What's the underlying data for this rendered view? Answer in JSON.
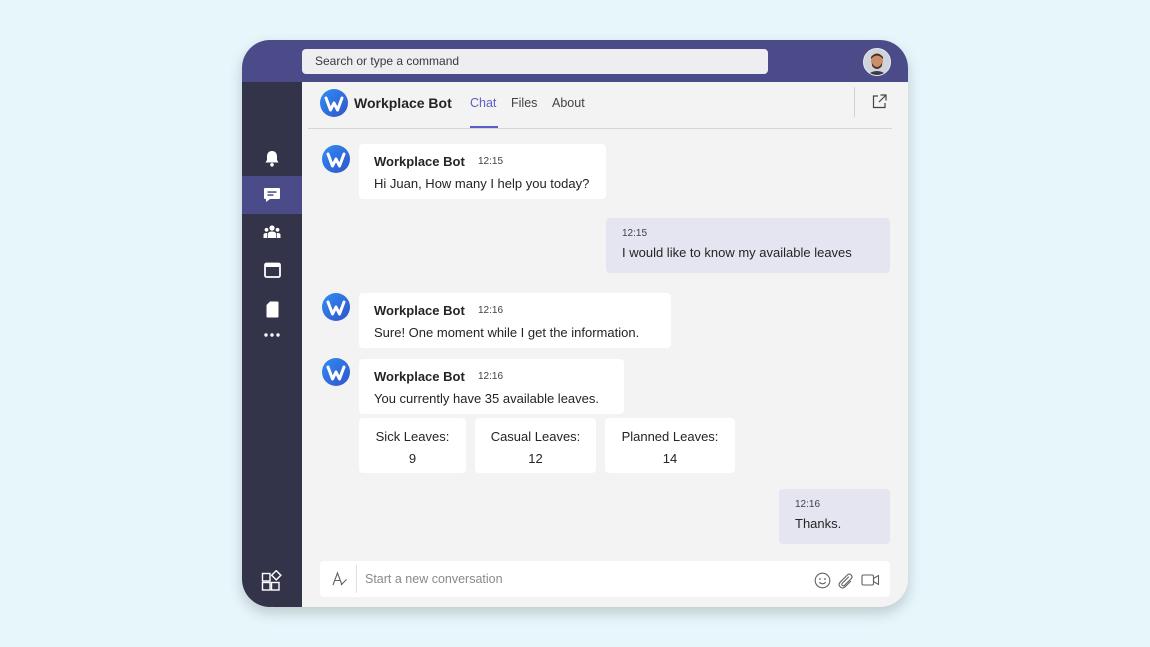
{
  "search": {
    "placeholder": "Search or type a command"
  },
  "header": {
    "bot_name": "Workplace Bot",
    "tabs": [
      {
        "label": "Chat",
        "active": true
      },
      {
        "label": "Files",
        "active": false
      },
      {
        "label": "About",
        "active": false
      }
    ]
  },
  "rail": {
    "items": [
      "bell-icon",
      "chat-icon",
      "teams-icon",
      "calendar-icon",
      "files-icon",
      "more-icon",
      "apps-icon",
      "help-icon"
    ],
    "active": "chat-icon"
  },
  "messages": [
    {
      "from": "bot",
      "name": "Workplace Bot",
      "time": "12:15",
      "text": "Hi Juan, How many I help you today?"
    },
    {
      "from": "me",
      "time": "12:15",
      "text": "I would like to know my available leaves"
    },
    {
      "from": "bot",
      "name": "Workplace Bot",
      "time": "12:16",
      "text": "Sure! One moment while I get the information."
    },
    {
      "from": "bot",
      "name": "Workplace Bot",
      "time": "12:16",
      "text": "You currently have 35 available leaves."
    },
    {
      "from": "me",
      "time": "12:16",
      "text": "Thanks."
    }
  ],
  "leave_cards": [
    {
      "label": "Sick Leaves:",
      "value": "9"
    },
    {
      "label": "Casual Leaves:",
      "value": "12"
    },
    {
      "label": "Planned Leaves:",
      "value": "14"
    }
  ],
  "composer": {
    "placeholder": "Start a new conversation"
  },
  "colors": {
    "brand": "#4b4b8a",
    "rail": "#33344a",
    "accent": "#5b5fc7",
    "my_bubble": "#e5e5f1"
  }
}
